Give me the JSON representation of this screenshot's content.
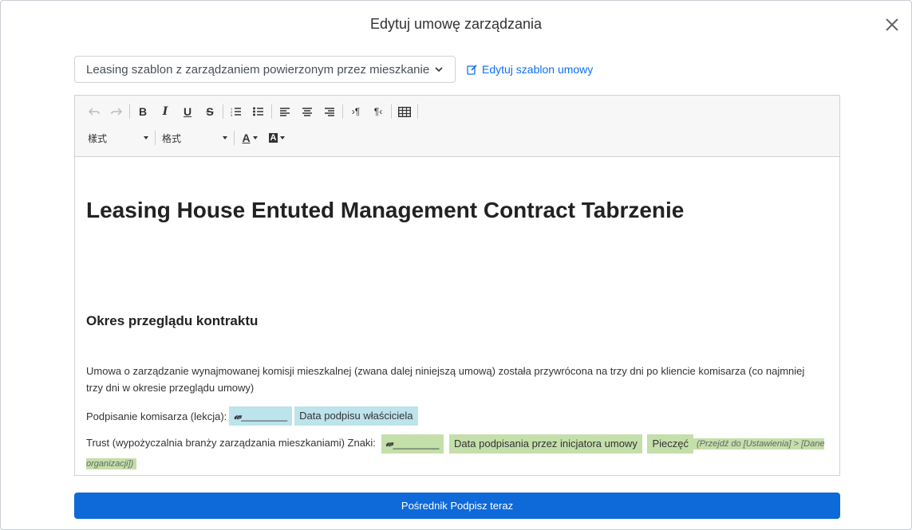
{
  "modal": {
    "title": "Edytuj umowę zarządzania",
    "close_icon": "close-icon"
  },
  "template": {
    "selected": "Leasing szablon z zarządzaniem powierzonym przez mieszkanie",
    "edit_link": "Edytuj szablon umowy"
  },
  "toolbar": {
    "style_dropdown": "樣式",
    "format_dropdown": "格式",
    "icons": [
      "undo-icon",
      "redo-icon",
      "bold-icon",
      "italic-icon",
      "underline-icon",
      "strikethrough-icon",
      "numbered-list-icon",
      "bullet-list-icon",
      "align-left-icon",
      "align-center-icon",
      "align-right-icon",
      "ltr-icon",
      "rtl-icon",
      "table-icon",
      "text-color-icon",
      "background-color-icon"
    ]
  },
  "document": {
    "title": "Leasing House Entuted Management Contract Tabrzenie",
    "subtitle": "Okres przeglądu kontraktu",
    "paragraph": "Umowa o zarządzanie wynajmowanej komisji mieszkalnej (zwana dalej niniejszą umową) została przywrócona na trzy dni po kliencie komisarza (co najmniej trzy dni w okresie przeglądu umowy)",
    "sig1_label": "Podpisanie komisarza (lekcja):",
    "sig1_field": "________",
    "sig1_date": "Data podpisu właściciela",
    "sig2_label": "Trust (wypożyczalnia branży zarządzania mieszkaniami) Znaki:",
    "sig2_field": "________",
    "sig2_date": "Data podpisania przez inicjatora umowy",
    "seal_label": "Pieczęć",
    "seal_hint": "(Przejdź do [Ustawienia] > [Dane organizacji])"
  },
  "actions": {
    "sign_button": "Pośrednik Podpisz teraz"
  },
  "colors": {
    "primary": "#0d6ad8",
    "chip_blue": "#bde3ec",
    "chip_green": "#c4dfaa"
  }
}
